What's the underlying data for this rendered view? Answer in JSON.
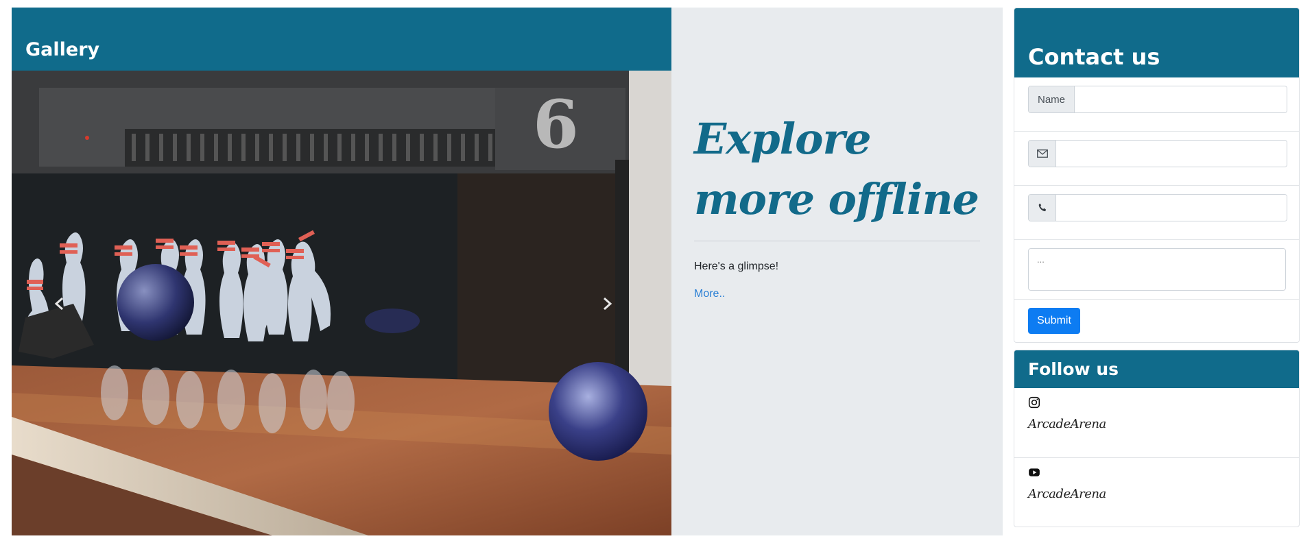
{
  "gallery": {
    "title": "Gallery",
    "lane_number": "6",
    "prev_label": "Previous",
    "next_label": "Next"
  },
  "promo": {
    "heading": "Explore more offline",
    "text": "Here's a glimpse!",
    "link": "More.."
  },
  "contact": {
    "title": "Contact us",
    "name_addon": "Name",
    "name_value": "",
    "email_value": "",
    "phone_value": "",
    "message_placeholder": "...",
    "submit_label": "Submit"
  },
  "follow": {
    "title": "Follow us",
    "accounts": [
      {
        "icon": "instagram-icon",
        "name": "ArcadeArena"
      },
      {
        "icon": "youtube-icon",
        "name": "ArcadeArena"
      }
    ]
  },
  "colors": {
    "brand": "#106b8b",
    "promo_bg": "#e8ebee",
    "button": "#0d7cf2"
  }
}
